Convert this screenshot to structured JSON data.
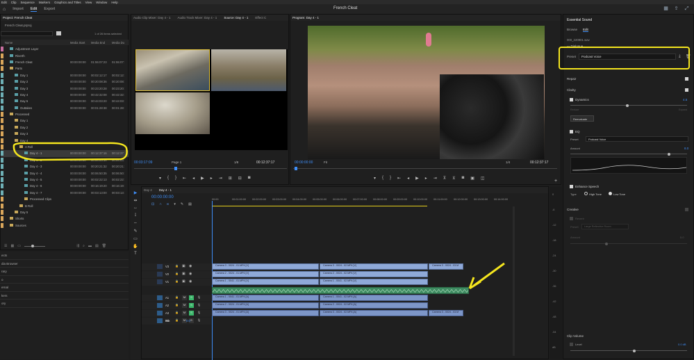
{
  "menu": [
    "Edit",
    "Clip",
    "Sequence",
    "Markers",
    "Graphics and Titles",
    "View",
    "Window",
    "Help"
  ],
  "workspaces": {
    "import": "Import",
    "edit": "Edit",
    "export": "Export"
  },
  "app_title": "French Cleat",
  "project": {
    "tab": "Project: French Cleat",
    "bin": "French Cleat.prproj",
    "count": "1 of 26 items selected",
    "headers": {
      "name": "Name",
      "media_start": "Media Start",
      "media_end": "Media End",
      "media_dur": "Media Du"
    },
    "rows": [
      {
        "name": "Adjustment Layer",
        "indent": 1,
        "color": "#c86fa0",
        "c1": "",
        "c2": "",
        "c3": ""
      },
      {
        "name": "Riverth",
        "indent": 1,
        "color": "#d9a65b",
        "c1": "",
        "c2": "",
        "c3": ""
      },
      {
        "name": "French Cleat",
        "indent": 1,
        "color": "#d9a65b",
        "c1": "00:00:00:00",
        "c2": "01:55:07:23",
        "c3": "01:55:07:"
      },
      {
        "name": "Parts",
        "indent": 1,
        "color": "#d9a65b",
        "c1": "",
        "c2": "",
        "c3": "",
        "folder": true
      },
      {
        "name": "Day 1",
        "indent": 2,
        "color": "#6fb0b6",
        "c1": "00:00:00:00",
        "c2": "00:02:12:17",
        "c3": "00:02:12:"
      },
      {
        "name": "Day 2",
        "indent": 2,
        "color": "#6fb0b6",
        "c1": "00:00:00:00",
        "c2": "00:20:08:36",
        "c3": "00:20:08:"
      },
      {
        "name": "Day 3",
        "indent": 2,
        "color": "#6fb0b6",
        "c1": "00:00:00:00",
        "c2": "00:23:20:28",
        "c3": "00:23:20:"
      },
      {
        "name": "Day 4",
        "indent": 2,
        "color": "#6fb0b6",
        "c1": "00:00:00:00",
        "c2": "00:42:32:08",
        "c3": "00:42:32:"
      },
      {
        "name": "Day 5",
        "indent": 2,
        "color": "#6fb0b6",
        "c1": "00:00:00:00",
        "c2": "00:44:03:20",
        "c3": "00:44:03:"
      },
      {
        "name": "Outtakes",
        "indent": 2,
        "color": "#6fb0b6",
        "c1": "00:00:00:00",
        "c2": "00:01:28:38",
        "c3": "00:01:28:"
      },
      {
        "name": "Processed",
        "indent": 1,
        "color": "#d9a65b",
        "c1": "",
        "c2": "",
        "c3": "",
        "folder": true
      },
      {
        "name": "Day 1",
        "indent": 2,
        "color": "#d9a65b",
        "c1": "",
        "c2": "",
        "c3": "",
        "folder": true
      },
      {
        "name": "Day 2",
        "indent": 2,
        "color": "#d9a65b",
        "c1": "",
        "c2": "",
        "c3": "",
        "folder": true
      },
      {
        "name": "Day 3",
        "indent": 2,
        "color": "#d9a65b",
        "c1": "",
        "c2": "",
        "c3": "",
        "folder": true
      },
      {
        "name": "Day 4",
        "indent": 2,
        "color": "#d9a65b",
        "c1": "",
        "c2": "",
        "c3": "",
        "folder": true
      },
      {
        "name": "A Roll",
        "indent": 3,
        "color": "#d9a65b",
        "c1": "",
        "c2": "",
        "c3": "",
        "folder": true
      },
      {
        "name": "Day 4 - 1",
        "indent": 4,
        "color": "#6fb0b6",
        "c1": "00:00:00:00",
        "c2": "00:12:37:16",
        "c3": "00:12:37:",
        "selected": true
      },
      {
        "name": "Day 4 - 2",
        "indent": 4,
        "color": "#6fb0b6",
        "c1": "00:00:00:00",
        "c2": "00:04:03:14",
        "c3": "00:04:03:"
      },
      {
        "name": "Day 4 - 3",
        "indent": 4,
        "color": "#6fb0b6",
        "c1": "00:00:00:00",
        "c2": "00:20:21:32",
        "c3": "00:20:21:"
      },
      {
        "name": "Day 4 - 4",
        "indent": 4,
        "color": "#6fb0b6",
        "c1": "00:00:00:00",
        "c2": "00:06:50:35",
        "c3": "00:06:50:"
      },
      {
        "name": "Day 4 - 5",
        "indent": 4,
        "color": "#6fb0b6",
        "c1": "00:00:00:00",
        "c2": "00:02:22:13",
        "c3": "00:02:22:"
      },
      {
        "name": "Day 4 - 6",
        "indent": 4,
        "color": "#6fb0b6",
        "c1": "00:00:00:00",
        "c2": "00:16:19:20",
        "c3": "00:16:19:"
      },
      {
        "name": "Day 4 - 7",
        "indent": 4,
        "color": "#6fb0b6",
        "c1": "00:00:00:00",
        "c2": "00:03:13:00",
        "c3": "00:03:13:"
      },
      {
        "name": "Processed Clips",
        "indent": 4,
        "color": "#d9a65b",
        "c1": "",
        "c2": "",
        "c3": "",
        "folder": true
      },
      {
        "name": "B Roll",
        "indent": 3,
        "color": "#d9a65b",
        "c1": "",
        "c2": "",
        "c3": "",
        "folder": true
      },
      {
        "name": "Day 5",
        "indent": 2,
        "color": "#d9a65b",
        "c1": "",
        "c2": "",
        "c3": "",
        "folder": true
      },
      {
        "name": "Shorts",
        "indent": 1,
        "color": "#d9a65b",
        "c1": "",
        "c2": "",
        "c3": "",
        "folder": true
      },
      {
        "name": "Sources",
        "indent": 1,
        "color": "#d9a65b",
        "c1": "",
        "c2": "",
        "c3": "",
        "folder": true
      }
    ]
  },
  "left_lower_panels": [
    "ects",
    "dia Browser",
    "rary",
    "o",
    "ernal",
    "kers",
    "ory"
  ],
  "source": {
    "tabs": [
      "Audio Clip Mixer: Day 4 - 1",
      "Audio Track Mixer: Day 4 - 1",
      "Source: Day 4 - 1",
      "Effect C"
    ],
    "timecode": "00:03:17:09",
    "page": "Page 1",
    "zoom": "1/8",
    "duration": "00:12:37:17"
  },
  "program": {
    "tab": "Program: Day 4 - 1",
    "timecode": "00:00:00:00",
    "fit": "Fit",
    "zoom": "1/4",
    "duration": "00:12:37:17"
  },
  "timeline": {
    "tabs": [
      "Day 4",
      "Day 4 - 1"
    ],
    "timecode": "00:00:00:00",
    "ruler": [
      "00:00",
      "00:01:00:00",
      "00:02:00:00",
      "00:03:00:00",
      "00:04:00:00",
      "00:05:00:00",
      "00:06:00:00",
      "00:07:00:00",
      "00:08:00:00",
      "00:09:00:00",
      "00:10:00:00",
      "00:11:00:00",
      "00:12:00:00",
      "00:13:00:00",
      "00:14:00:00"
    ],
    "video_tracks": [
      "V3",
      "V2",
      "V1"
    ],
    "audio_tracks": [
      "A1",
      "A2",
      "A3",
      "A4"
    ],
    "mix": {
      "label": "Mix",
      "value": "0.0"
    },
    "clips": {
      "v3": [
        "Camera 3 - 0024 - 01.MP4 [V]",
        "Camera 3 - 0024 - 02.MP4 [V]",
        "Camera 3 - 0024 - 03.M"
      ],
      "v2": [
        "Camera 2 - 0024 - 01.MP4 [V]",
        "Camera 2 - 0024 - 02.MP4 [V]"
      ],
      "v1": [
        "Camera 1 - 0041 - 01.MP4 [V]",
        "Camera 1 - 0041 - 02.MP4 [V]"
      ],
      "a1": [
        "Camera 1 - 0041 - 01.MP4 [A]",
        "Camera 1 - 0041 - 02.MP4 [A]"
      ],
      "a2": [
        "Camera 2 - 0024 - 01.MP4 [A]",
        "Camera 2 - 0024 - 02.MP4 [A]"
      ],
      "a3": [
        "Camera 3 - 0024 - 01.MP4 [A]",
        "Camera 3 - 0024 - 02.MP4 [A]",
        "Camera 3 - 0024 - 03.M"
      ]
    },
    "db_scale": [
      "0",
      "-6",
      "-12",
      "-18",
      "-24",
      "-30",
      "-36",
      "-42",
      "-48",
      "-54",
      "dB"
    ]
  },
  "essential_sound": {
    "title": "Essential Sound",
    "tabs": [
      "Browse",
      "Edit"
    ],
    "clip": "000_220901.wav",
    "type": "Dialogue",
    "preset_label": "Preset",
    "preset_value": "Podcast Voice",
    "sections": {
      "repair": "Repair",
      "clarity": "Clarity",
      "dynamics": "Dynamics",
      "dynamics_value": "4.5",
      "reduce": "Reduce",
      "expand": "Expand",
      "reevaluate": "Reevaluate",
      "eq": "EQ",
      "eq_preset": "Podcast Voice",
      "amount": "Amount",
      "amount_value": "8.0",
      "enhance": "Enhance Speech",
      "type_label": "Type",
      "high_tone": "High Tone",
      "low_tone": "Low Tone",
      "creative": "Creative",
      "reverb": "Reverb",
      "reverb_preset": "Large Reflective Room",
      "reverb_amount": "Amount",
      "reverb_value": "5.0",
      "clip_volume": "Clip Volume",
      "level": "Level",
      "level_value": "0.0 dB"
    }
  },
  "colors": {
    "accent": "#3f8ef7",
    "highlight": "#f5e61e",
    "audio_green": "#3e8b61"
  }
}
